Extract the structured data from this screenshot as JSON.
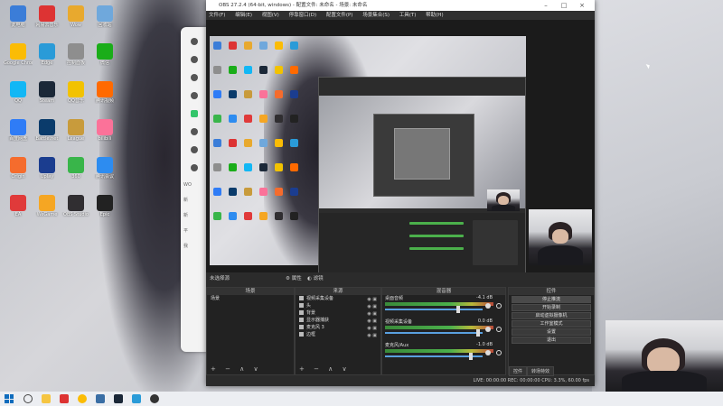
{
  "window": {
    "title": "OBS 27.2.4 (64-bit, windows) - 配置文件: 未命名 - 场景: 未命名",
    "menu": [
      "文件(F)",
      "编辑(E)",
      "视图(V)",
      "停靠窗口(D)",
      "配置文件(P)",
      "场景集合(S)",
      "工具(T)",
      "帮助(H)"
    ]
  },
  "scene_bar": {
    "current": "未选择源",
    "props_label": "属性",
    "filters_label": "滤镜"
  },
  "docks": {
    "scenes": {
      "title": "场景",
      "items": [
        "场景"
      ]
    },
    "sources": {
      "title": "来源",
      "items": [
        "视频采集设备",
        "头",
        "背景",
        "显示器捕获",
        "麦克风 3",
        "边框"
      ]
    },
    "mixer": {
      "title": "混音器",
      "channels": [
        {
          "name": "桌面音频",
          "db": "-4.1 dB"
        },
        {
          "name": "视频采集设备",
          "db": "0.0 dB"
        },
        {
          "name": "麦克风/Aux",
          "db": "-1.0 dB"
        }
      ]
    },
    "controls": {
      "title": "控件",
      "buttons": [
        "停止推流",
        "开始录制",
        "启动虚拟摄像机",
        "工作室模式",
        "设置",
        "退出"
      ]
    },
    "tabs": [
      "控件",
      "转场特效"
    ],
    "footer_glyphs": "+ − ∧ ∨"
  },
  "status": {
    "text": "LIVE: 00:00:00   REC: 00:00:00   CPU: 3.3%, 60.00 fps"
  },
  "desktop": {
    "icons": [
      "此电脑",
      "网易云音乐",
      "Wow",
      "回收站",
      "Google Chrome",
      "Edge",
      "控制面板",
      "微信",
      "QQ",
      "Steam",
      "QQ音乐",
      "腾讯视频",
      "百度网盘",
      "Battle.net",
      "League",
      "bilibili",
      "Origin",
      "Uplay",
      "360",
      "腾讯会议",
      "EA",
      "WeGame",
      "OBS Studio",
      "Epic"
    ],
    "colors": {
      "accent_green": "#33c56a",
      "obs_bg": "#2b2b2b",
      "windows_blue": "#0f6cbd"
    }
  },
  "side_app": {
    "items": [
      "WO",
      "新",
      "新",
      "平",
      "我"
    ]
  }
}
